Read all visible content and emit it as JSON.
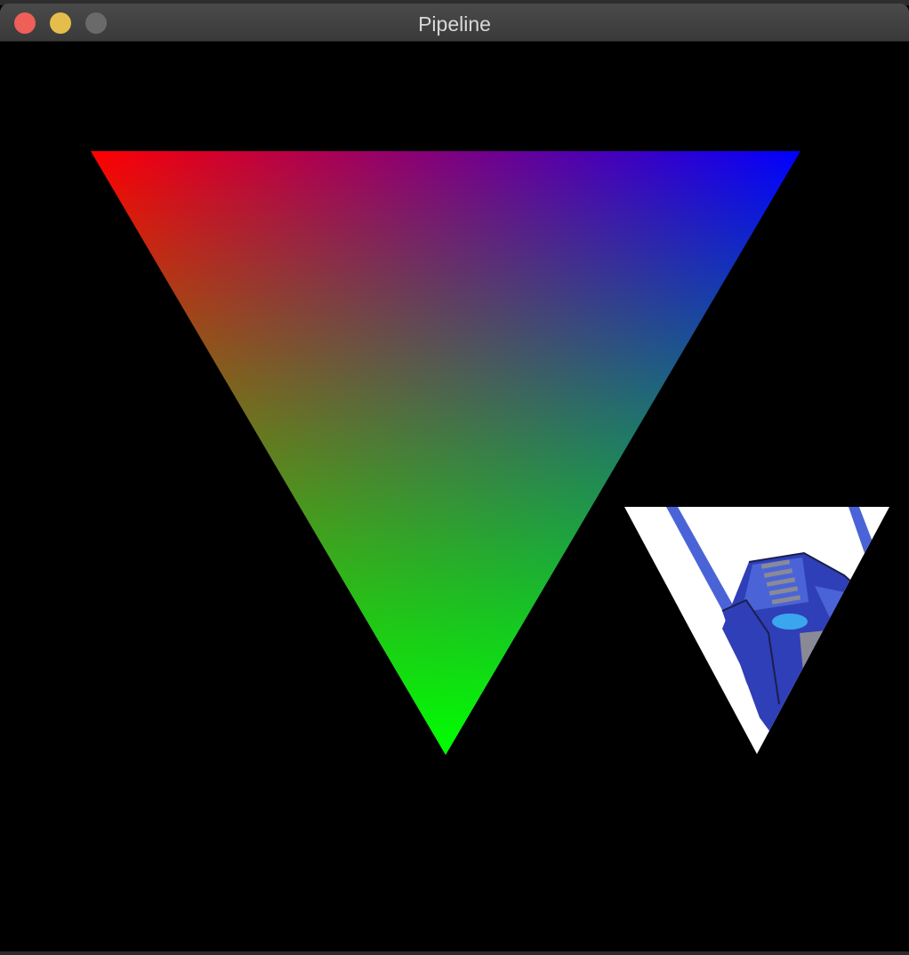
{
  "window": {
    "title": "Pipeline",
    "controls": {
      "close_color": "#ee5f57",
      "minimize_color": "#e5bd4a",
      "zoom_color": "#6a6a6a"
    }
  },
  "scene": {
    "background": "#000000",
    "color_triangle": {
      "vertex_colors": {
        "top_left": "#ff0000",
        "top_right": "#0000ff",
        "bottom": "#00ff00"
      }
    },
    "texture_triangle": {
      "background": "#ffffff",
      "texture_colors": {
        "primary_blue": "#2f3fb8",
        "light_blue": "#4a64d8",
        "visor_cyan": "#3aa6ee",
        "grey_vent": "#8a8a96"
      }
    }
  }
}
